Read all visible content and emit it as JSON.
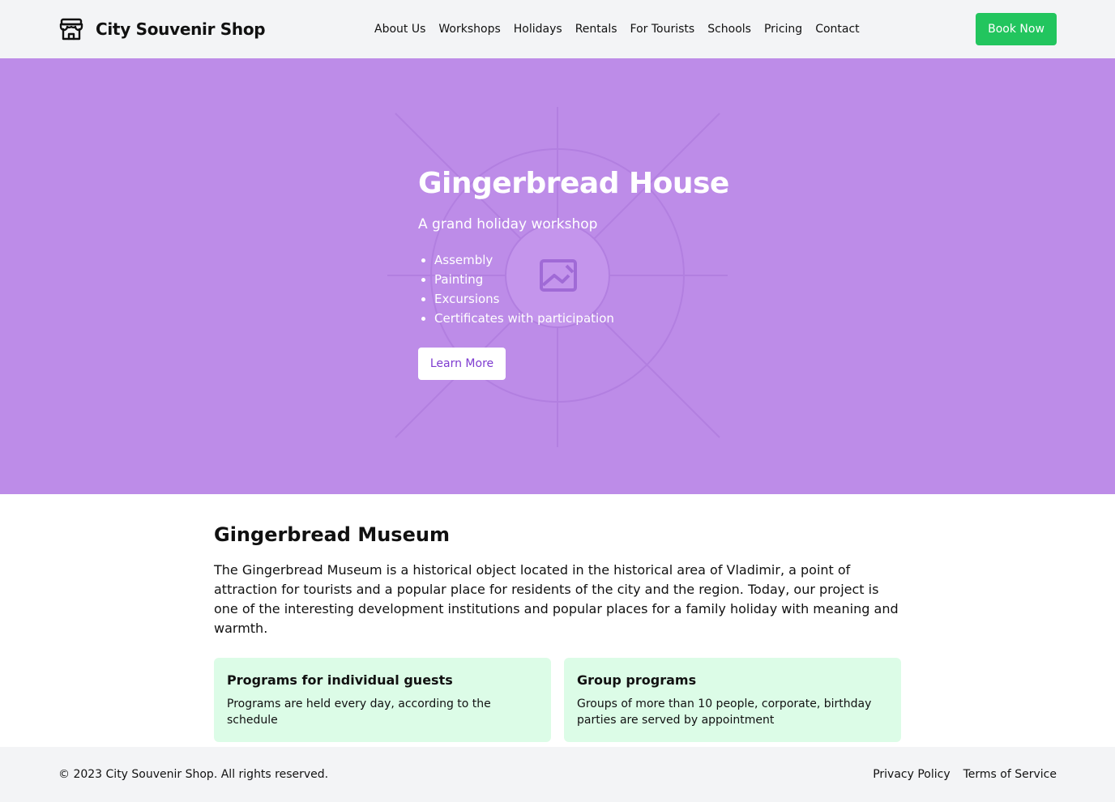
{
  "header": {
    "brand_name": "City Souvenir Shop",
    "brand_icon": "storefront-icon",
    "nav": [
      "About Us",
      "Workshops",
      "Holidays",
      "Rentals",
      "For Tourists",
      "Schools",
      "Pricing",
      "Contact"
    ],
    "book_label": "Book Now"
  },
  "hero": {
    "title": "Gingerbread House",
    "subtitle": "A grand holiday workshop",
    "features": [
      "Assembly",
      "Painting",
      "Excursions",
      "Certificates with participation"
    ],
    "cta_label": "Learn More",
    "image_icon": "image-placeholder-icon"
  },
  "main": {
    "title": "Gingerbread Museum",
    "description": "The Gingerbread Museum is a historical object located in the historical area of Vladimir, a point of attraction for tourists and a popular place for residents of the city and the region. Today, our project is one of the interesting development institutions and popular places for a family holiday with meaning and warmth.",
    "cards": [
      {
        "title": "Programs for individual guests",
        "text": "Programs are held every day, according to the schedule"
      },
      {
        "title": "Group programs",
        "text": "Groups of more than 10 people, corporate, birthday parties are served by appointment"
      }
    ]
  },
  "footer": {
    "copyright": "© 2023 City Souvenir Shop. All rights reserved.",
    "links": [
      "Privacy Policy",
      "Terms of Service"
    ]
  },
  "colors": {
    "hero_bg": "#bd8ce8",
    "accent_green": "#22c55e",
    "card_bg": "#dcfce7",
    "header_bg": "#f3f4f6",
    "learn_more_text": "#7e3bd0"
  }
}
